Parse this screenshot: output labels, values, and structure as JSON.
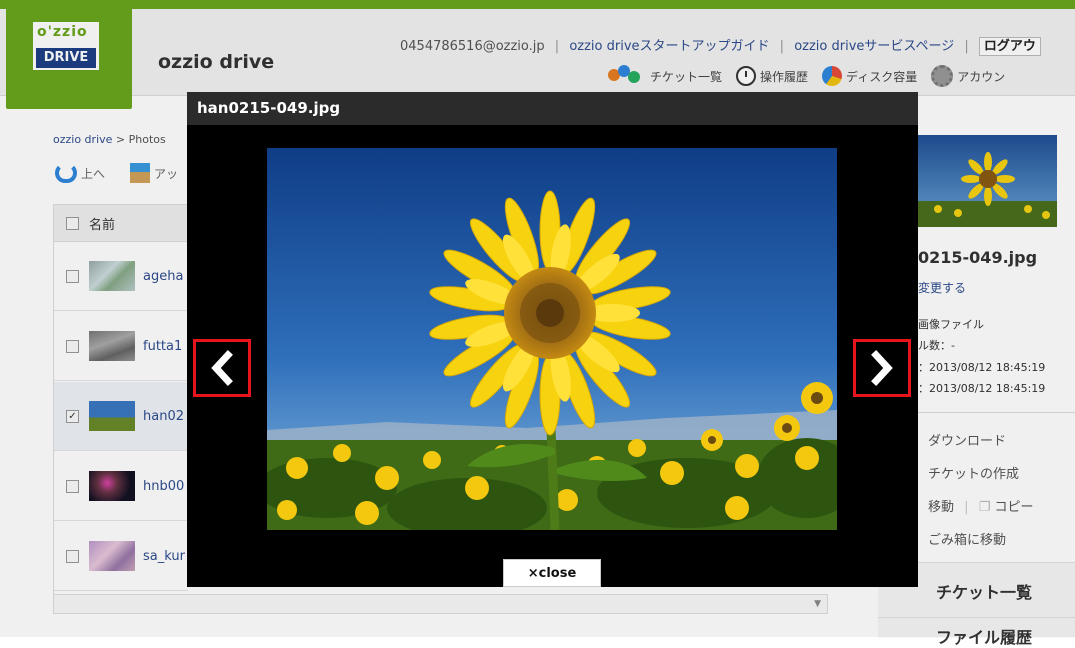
{
  "header": {
    "logo_top": "o'zzio",
    "logo_bottom": "DRIVE",
    "app_title": "ozzio drive",
    "account": "0454786516@ozzio.jp",
    "links": [
      "ozzio driveスタートアップガイド",
      "ozzio driveサービスページ"
    ],
    "logout": "ログアウ",
    "nav": [
      {
        "icon": "tickets-icon",
        "label": "チケット一覧"
      },
      {
        "icon": "clock-icon",
        "label": "操作履歴"
      },
      {
        "icon": "disk-usage-icon",
        "label": "ディスク容量"
      },
      {
        "icon": "gear-icon",
        "label": "アカウン"
      }
    ]
  },
  "breadcrumb": {
    "root": "ozzio drive",
    "sep": ">",
    "current": "Photos"
  },
  "toolbar": {
    "up_label": "上へ",
    "upload_label": "アッ"
  },
  "file_list": {
    "header": "名前",
    "rows": [
      {
        "name": "ageha",
        "checked": false
      },
      {
        "name": "futta1",
        "checked": false
      },
      {
        "name": "han02",
        "checked": true
      },
      {
        "name": "hnb00",
        "checked": false
      },
      {
        "name": "sa_kur",
        "checked": false
      }
    ]
  },
  "detail": {
    "filename": "0215-049.jpg",
    "rename": "変更する",
    "type": "画像ファイル",
    "count": "ル数：-",
    "created": "：2013/08/12 18:45:19",
    "modified": "：2013/08/12 18:45:19",
    "actions": [
      "ダウンロード",
      "チケットの作成",
      "移動",
      "コピー",
      "ごみ箱に移動"
    ],
    "panel_ticket": "チケット一覧",
    "panel_history": "ファイル履歴"
  },
  "lightbox": {
    "title": "han0215-049.jpg",
    "close_label": "×close",
    "prev_icon": "chevron-left-icon",
    "next_icon": "chevron-right-icon"
  },
  "colors": {
    "brand_green": "#6aa51c",
    "logo_blue": "#1d3f86",
    "highlight_red": "#e8141b",
    "link_blue": "#2e4d8f"
  }
}
